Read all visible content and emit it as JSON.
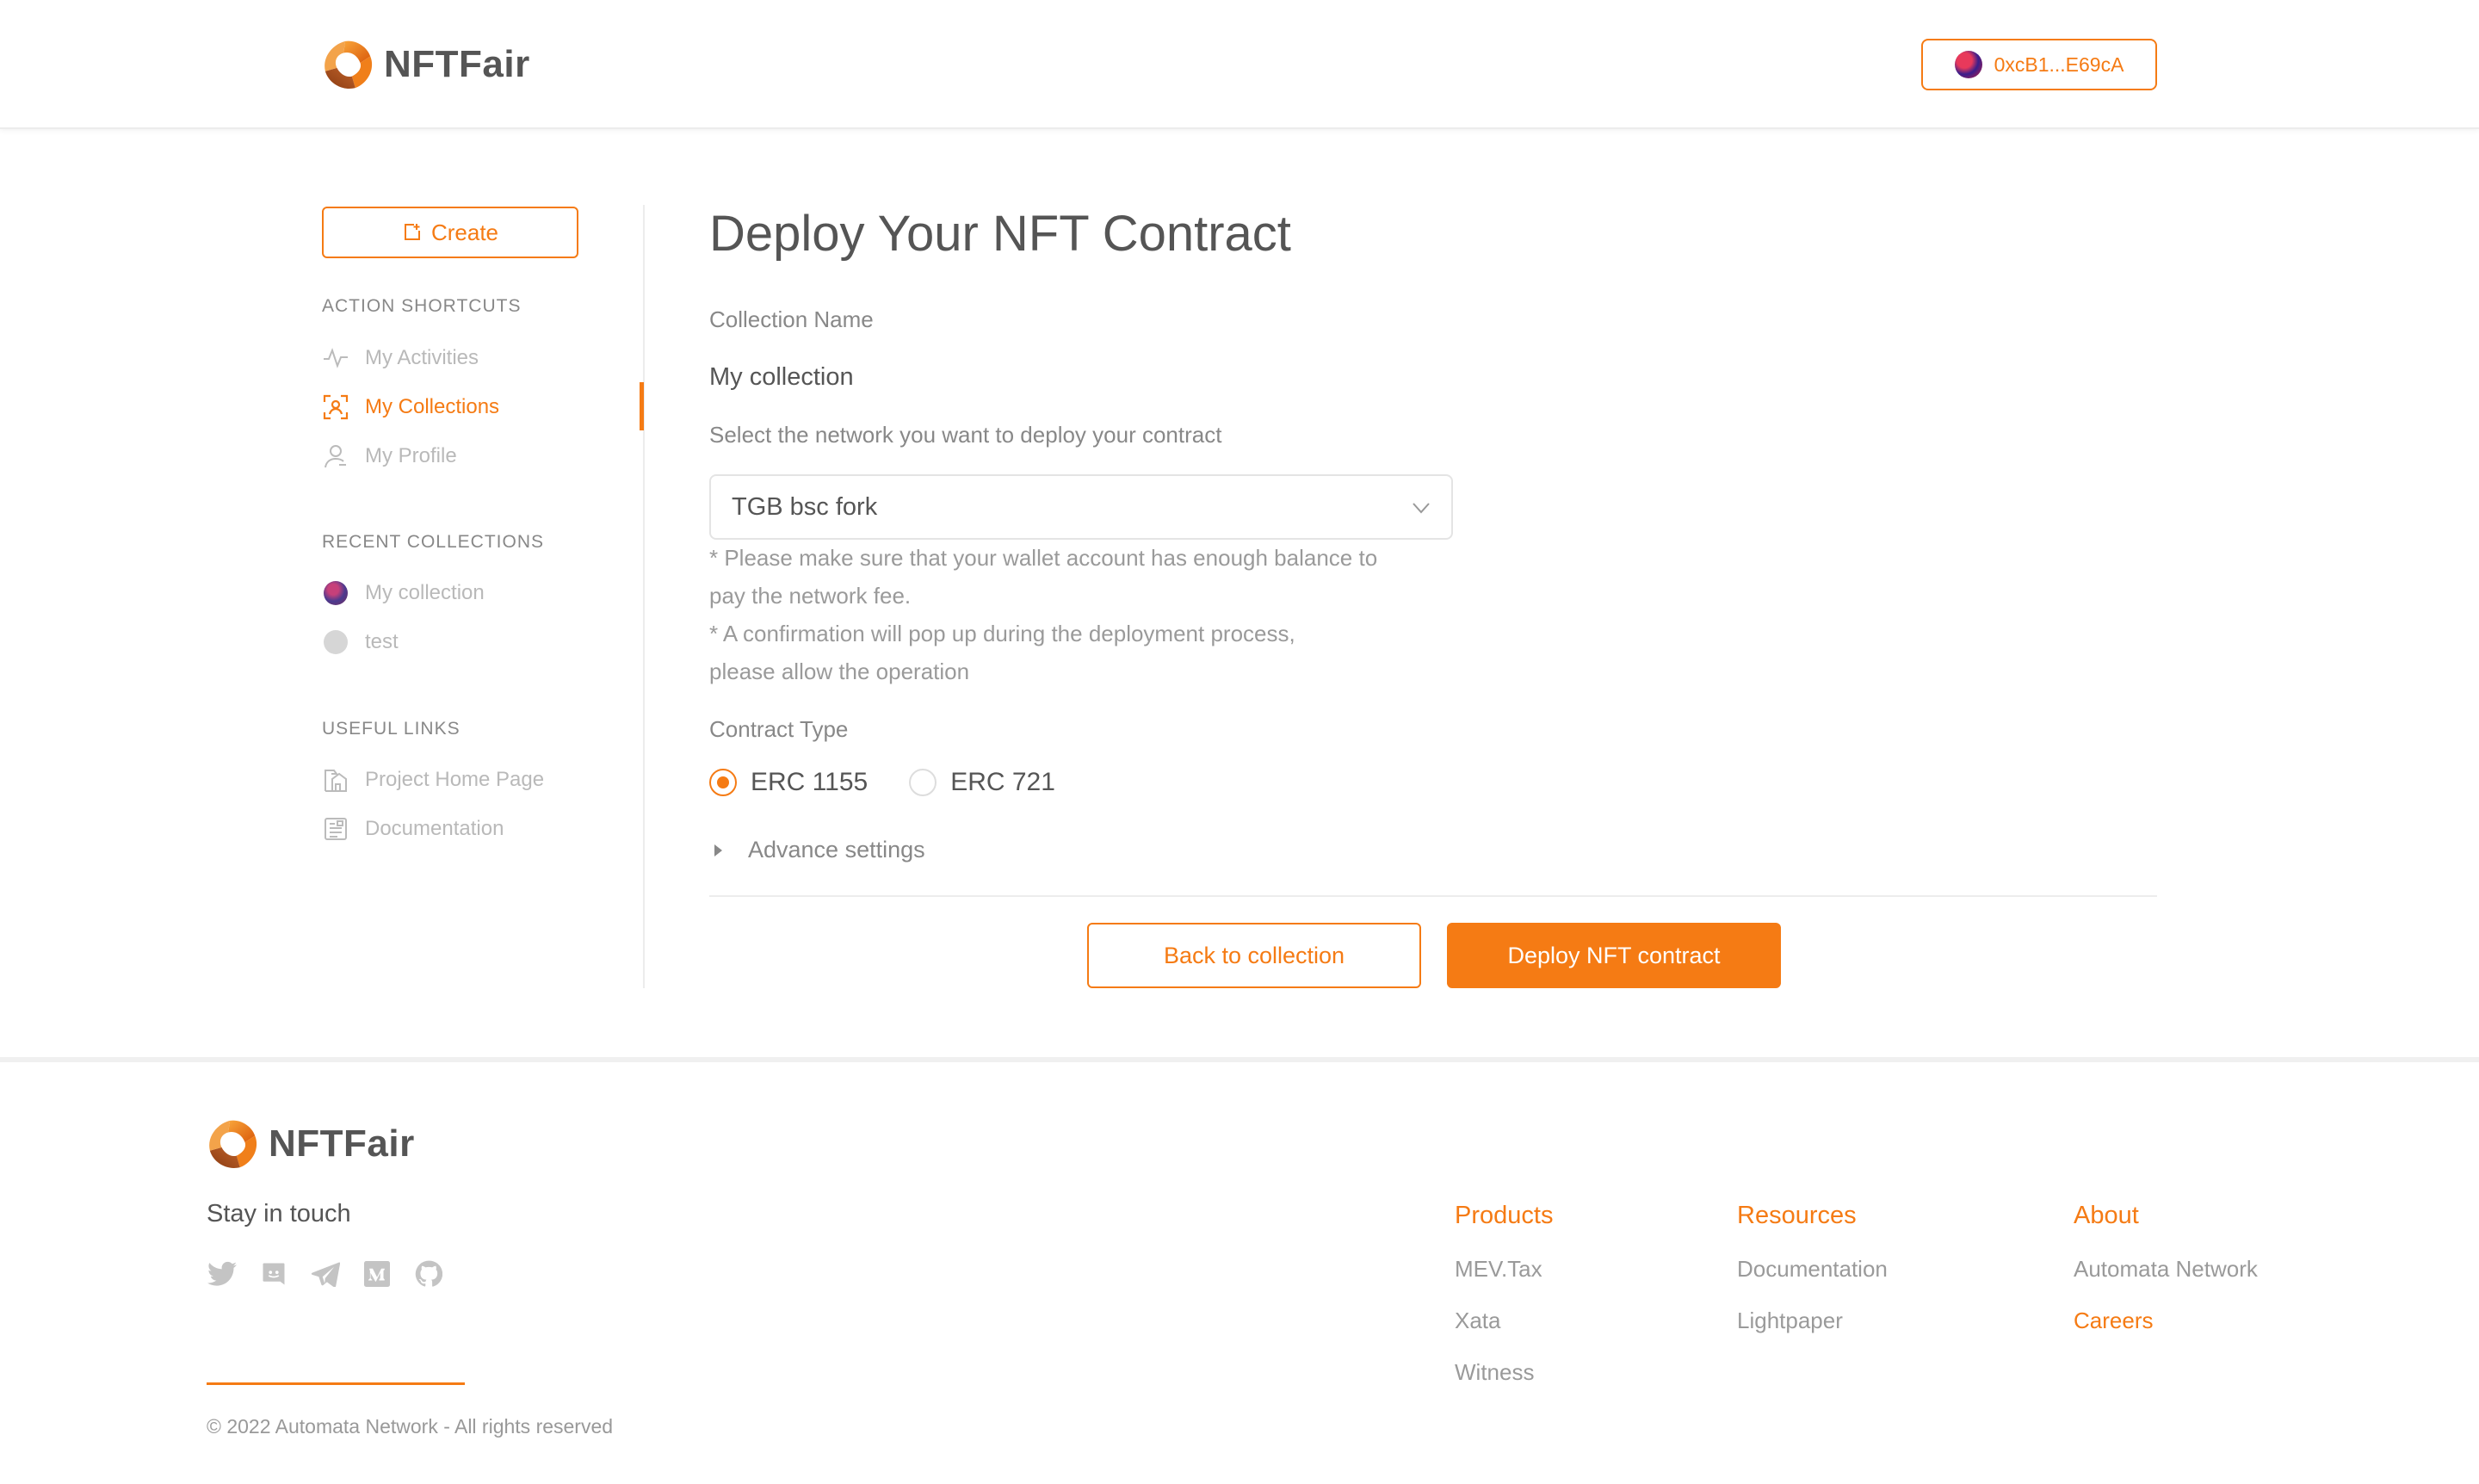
{
  "header": {
    "brand": "NFTFair",
    "wallet_address": "0xcB1...E69cA"
  },
  "sidebar": {
    "create_label": "Create",
    "shortcuts_title": "ACTION SHORTCUTS",
    "shortcuts": [
      {
        "label": "My Activities",
        "icon": "activity-icon"
      },
      {
        "label": "My Collections",
        "icon": "collections-icon",
        "active": true
      },
      {
        "label": "My Profile",
        "icon": "user-icon"
      }
    ],
    "recent_title": "RECENT COLLECTIONS",
    "recent": [
      {
        "label": "My collection"
      },
      {
        "label": "test"
      }
    ],
    "links_title": "USEFUL LINKS",
    "links": [
      {
        "label": "Project Home Page",
        "icon": "home-icon"
      },
      {
        "label": "Documentation",
        "icon": "document-icon"
      }
    ]
  },
  "main": {
    "title": "Deploy Your NFT Contract",
    "collection_name_label": "Collection Name",
    "collection_name": "My collection",
    "network_label": "Select the network you want to deploy your contract",
    "network_selected": "TGB bsc fork",
    "notes": [
      "* Please make sure that your wallet account has enough balance to",
      "pay the network fee.",
      "* A confirmation will pop up during the deployment process,",
      "please allow the operation"
    ],
    "contract_type_label": "Contract Type",
    "contract_types": [
      {
        "label": "ERC 1155",
        "selected": true
      },
      {
        "label": "ERC 721",
        "selected": false
      }
    ],
    "advance_label": "Advance settings",
    "back_label": "Back to collection",
    "deploy_label": "Deploy NFT contract"
  },
  "footer": {
    "brand": "NFTFair",
    "stay_in_touch": "Stay in touch",
    "socials": [
      "twitter-icon",
      "discord-icon",
      "telegram-icon",
      "medium-icon",
      "github-icon"
    ],
    "copyright": "© 2022 Automata Network - All rights reserved",
    "columns": [
      {
        "title": "Products",
        "links": [
          "MEV.Tax",
          "Xata",
          "Witness"
        ]
      },
      {
        "title": "Resources",
        "links": [
          "Documentation",
          "Lightpaper"
        ]
      },
      {
        "title": "About",
        "links": [
          "Automata Network",
          "Careers"
        ]
      }
    ]
  },
  "colors": {
    "accent": "#f57b14",
    "text": "#555555",
    "muted": "#9a9a9a"
  }
}
